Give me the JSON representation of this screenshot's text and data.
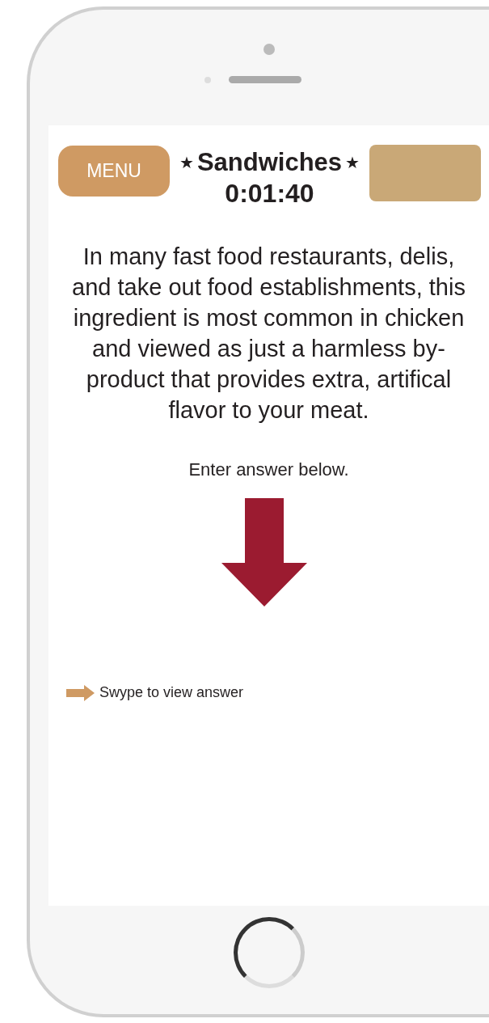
{
  "header": {
    "menu_button": "MENU",
    "star_left": "★",
    "title": "Sandwiches",
    "star_right": "★",
    "timer": "0:01:40"
  },
  "question": "In many fast food restaurants, delis, and take out food establishments, this ingredient is most common in chicken and viewed as just a harmless by-product that provides extra, artifical flavor to your meat.",
  "prompt": "Enter answer below.",
  "swipe_hint": "Swype to view answer"
}
